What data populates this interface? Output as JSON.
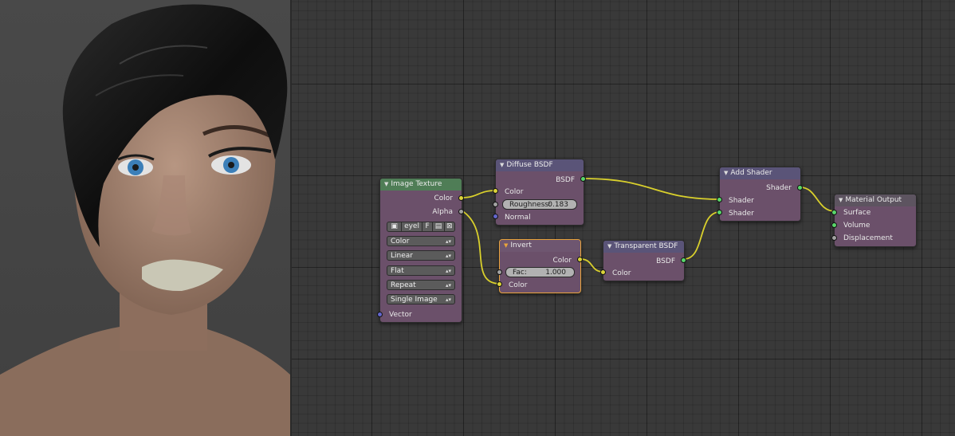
{
  "viewport": {
    "description_icon": "character-render"
  },
  "nodes": {
    "image_texture": {
      "title": "Image Texture",
      "out_color": "Color",
      "out_alpha": "Alpha",
      "image_name": "eyel",
      "fake_user": "F",
      "open_icon": "folder-icon",
      "unlink_icon": "close-icon",
      "color_space": "Color",
      "interpolation": "Linear",
      "projection": "Flat",
      "extension": "Repeat",
      "source": "Single Image",
      "in_vector": "Vector"
    },
    "diffuse_bsdf": {
      "title": "Diffuse BSDF",
      "out_bsdf": "BSDF",
      "in_color": "Color",
      "roughness_label": "Roughness:",
      "roughness_value": "0.183",
      "in_normal": "Normal"
    },
    "invert": {
      "title": "Invert",
      "out_color": "Color",
      "fac_label": "Fac:",
      "fac_value": "1.000",
      "in_color": "Color"
    },
    "transparent_bsdf": {
      "title": "Transparent BSDF",
      "out_bsdf": "BSDF",
      "in_color": "Color"
    },
    "add_shader": {
      "title": "Add Shader",
      "out_shader": "Shader",
      "in_shader_1": "Shader",
      "in_shader_2": "Shader"
    },
    "material_output": {
      "title": "Material Output",
      "in_surface": "Surface",
      "in_volume": "Volume",
      "in_displacement": "Displacement"
    }
  },
  "colors": {
    "link": "#d9d02c",
    "active_border": "#e9a33b",
    "node_body": "#6b506a"
  }
}
